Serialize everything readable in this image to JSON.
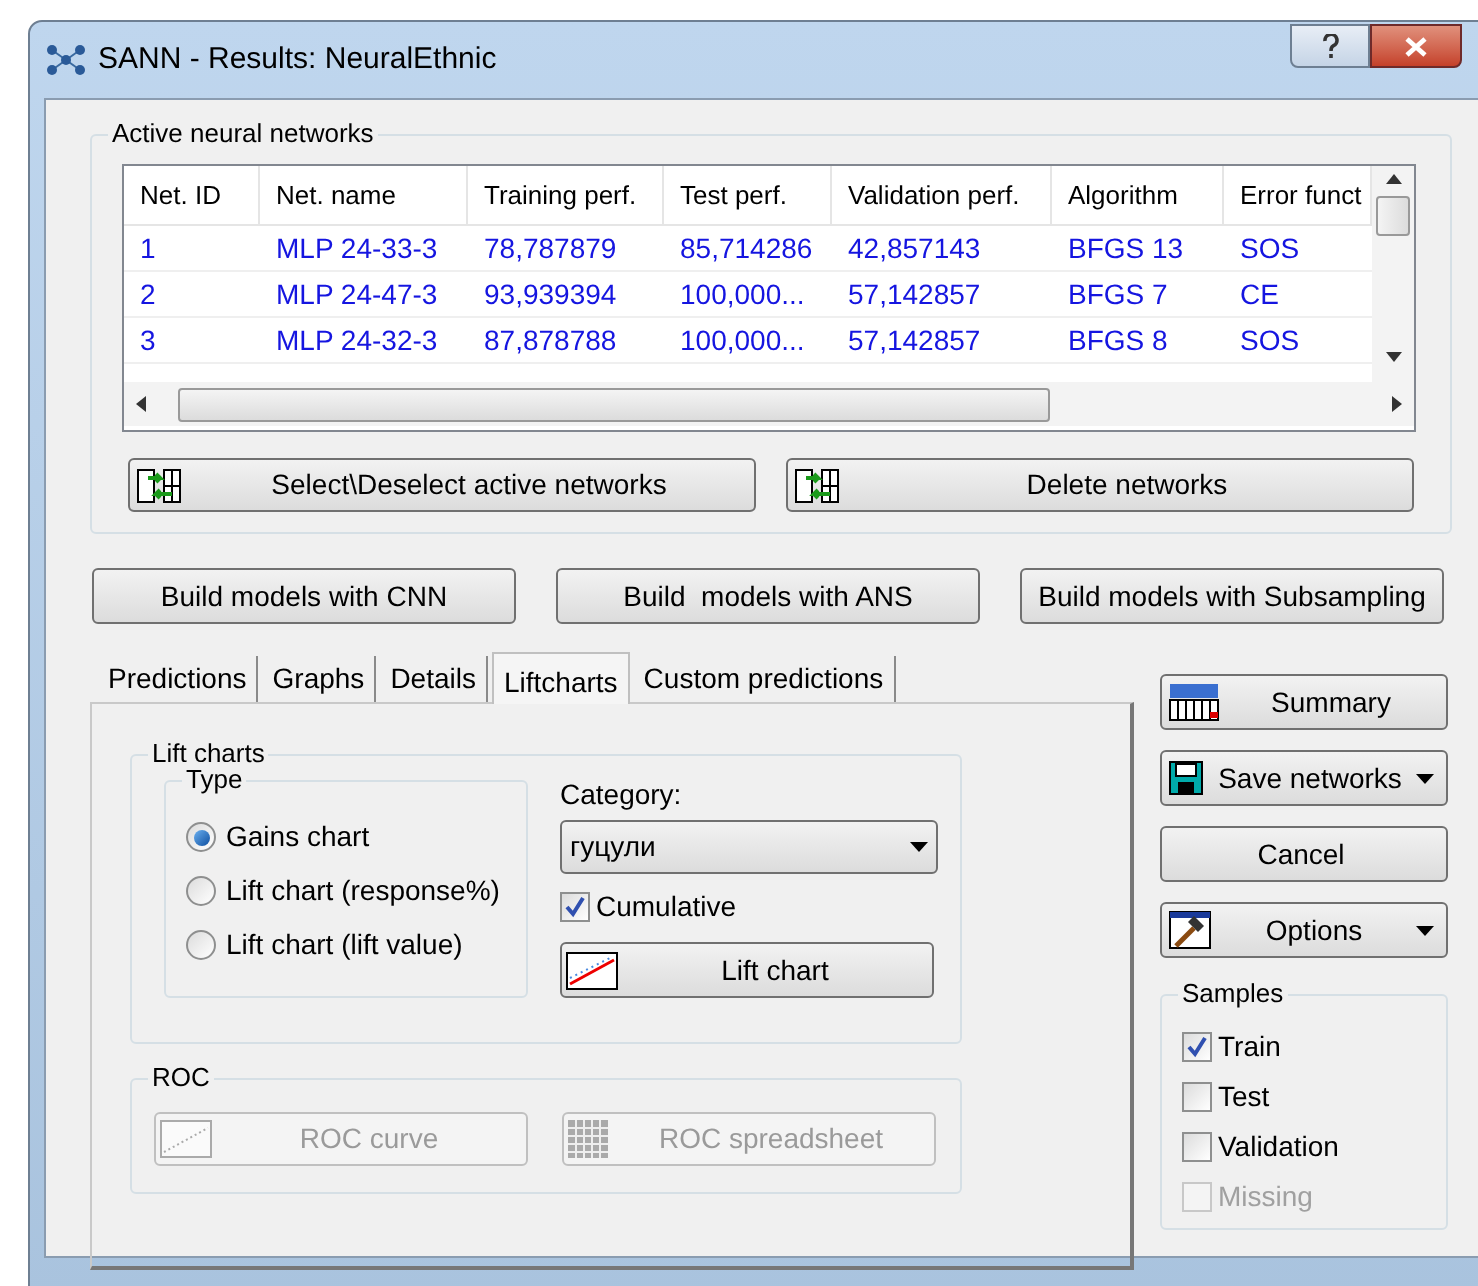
{
  "window": {
    "title": "SANN - Results: NeuralEthnic"
  },
  "networks": {
    "label": "Active neural networks",
    "columns": [
      "Net. ID",
      "Net. name",
      "Training perf.",
      "Test perf.",
      "Validation perf.",
      "Algorithm",
      "Error funct"
    ],
    "rows": [
      [
        "1",
        "MLP 24-33-3",
        "78,787879",
        "85,714286",
        "42,857143",
        "BFGS 13",
        "SOS"
      ],
      [
        "2",
        "MLP 24-47-3",
        "93,939394",
        "100,000...",
        "57,142857",
        "BFGS 7",
        "CE"
      ],
      [
        "3",
        "MLP 24-32-3",
        "87,878788",
        "100,000...",
        "57,142857",
        "BFGS 8",
        "SOS"
      ]
    ]
  },
  "network_buttons": [
    "Select\\Deselect active networks",
    "Delete networks"
  ],
  "build_buttons": [
    "Build models with CNN",
    "Build  models with ANS",
    "Build models with Subsampling"
  ],
  "tabs": [
    {
      "label": "Predictions",
      "selected": false
    },
    {
      "label": "Graphs",
      "selected": false
    },
    {
      "label": "Details",
      "selected": false
    },
    {
      "label": "Liftcharts",
      "selected": true
    },
    {
      "label": "Custom predictions",
      "selected": false
    }
  ],
  "lift_charts": {
    "label": "Lift charts",
    "type": {
      "label": "Type",
      "options": [
        {
          "label": "Gains chart",
          "selected": true
        },
        {
          "label": "Lift chart (response%)",
          "selected": false
        },
        {
          "label": "Lift chart (lift value)",
          "selected": false
        }
      ]
    },
    "category": {
      "label": "Category:",
      "value": "гуцули"
    },
    "cumulative": {
      "label": "Cumulative",
      "checked": true
    },
    "button": "Lift chart"
  },
  "roc": {
    "label": "ROC",
    "buttons": [
      {
        "label": "ROC curve",
        "kind": "curve",
        "disabled": true
      },
      {
        "label": "ROC spreadsheet",
        "kind": "sheet",
        "disabled": true
      }
    ]
  },
  "side_buttons": [
    {
      "label": "Summary",
      "kind": "summary",
      "dropdown": false
    },
    {
      "label": "Save networks",
      "kind": "save",
      "dropdown": true
    },
    {
      "label": "Cancel",
      "kind": "plain",
      "dropdown": false
    },
    {
      "label": "Options",
      "kind": "options",
      "dropdown": true
    }
  ],
  "samples": {
    "label": "Samples",
    "items": [
      {
        "label": "Train",
        "checked": true,
        "disabled": false
      },
      {
        "label": "Test",
        "checked": false,
        "disabled": false
      },
      {
        "label": "Validation",
        "checked": false,
        "disabled": false
      },
      {
        "label": "Missing",
        "checked": false,
        "disabled": true
      }
    ]
  }
}
